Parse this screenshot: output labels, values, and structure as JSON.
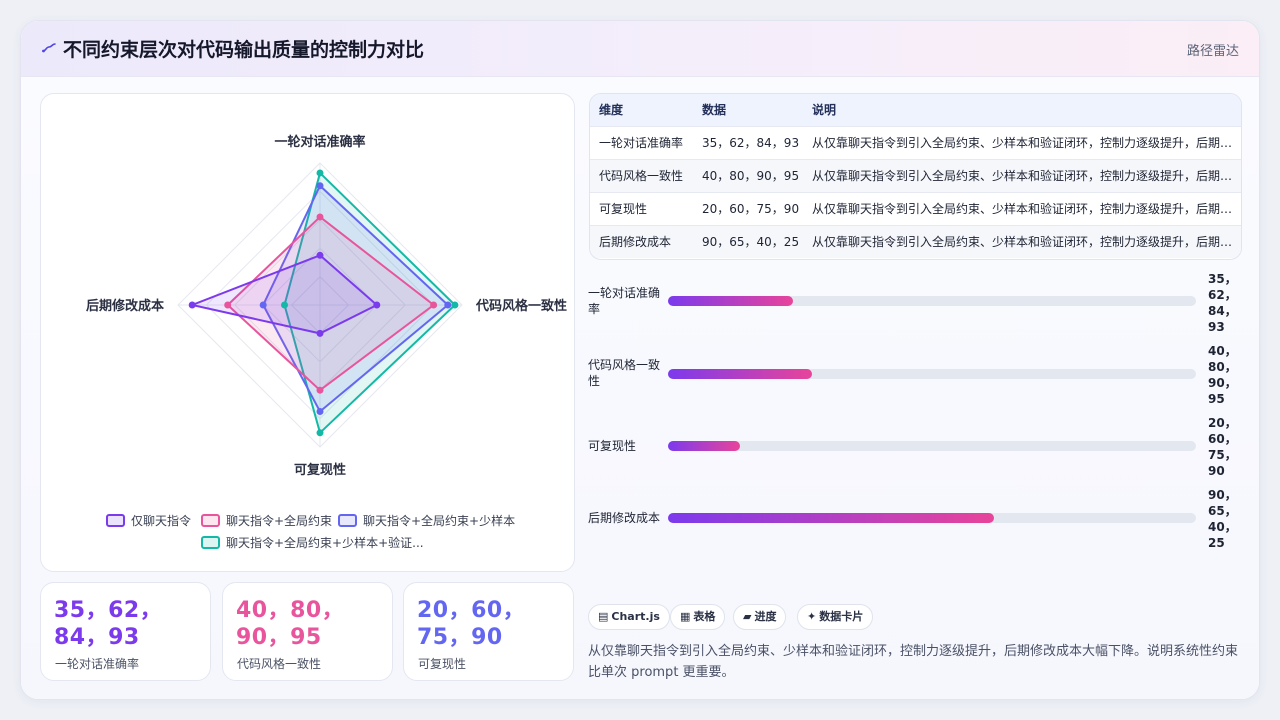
{
  "header": {
    "title": "不同约束层次对代码输出质量的控制力对比",
    "badge": "路径雷达",
    "logo_icon": "route-icon"
  },
  "chart_data": {
    "type": "radar",
    "axes": [
      "一轮对话准确率",
      "代码风格一致性",
      "可复现性",
      "后期修改成本"
    ],
    "range": [
      0,
      100
    ],
    "series": [
      {
        "name": "仅聊天指令",
        "values": [
          35,
          40,
          20,
          90
        ],
        "color": "#7c3aed"
      },
      {
        "name": "聊天指令+全局约束",
        "values": [
          62,
          80,
          60,
          65
        ],
        "color": "#e8559c"
      },
      {
        "name": "聊天指令+全局约束+少样本",
        "values": [
          84,
          90,
          75,
          40
        ],
        "color": "#6366f1"
      },
      {
        "name": "聊天指令+全局约束+少样本+验证...",
        "values": [
          93,
          95,
          90,
          25
        ],
        "color": "#14b8a6"
      }
    ],
    "legend_position": "bottom"
  },
  "kpis": [
    {
      "value": "35，62，84，93",
      "label": "一轮对话准确率",
      "color": "#7c3aed"
    },
    {
      "value": "40，80，90，95",
      "label": "代码风格一致性",
      "color": "#e8559c"
    },
    {
      "value": "20，60，75，90",
      "label": "可复现性",
      "color": "#6366f1"
    }
  ],
  "table": {
    "headers": [
      "维度",
      "数据",
      "说明"
    ],
    "rows": [
      [
        "一轮对话准确率",
        "35，62，84，93",
        "从仅靠聊天指令到引入全局约束、少样本和验证闭环，控制力逐级提升，后期修改成本大幅下降。"
      ],
      [
        "代码风格一致性",
        "40，80，90，95",
        "从仅靠聊天指令到引入全局约束、少样本和验证闭环，控制力逐级提升，后期修改成本大幅下降。"
      ],
      [
        "可复现性",
        "20，60，75，90",
        "从仅靠聊天指令到引入全局约束、少样本和验证闭环，控制力逐级提升，后期修改成本大幅下降。"
      ],
      [
        "后期修改成本",
        "90，65，40，25",
        "从仅靠聊天指令到引入全局约束、少样本和验证闭环，控制力逐级提升，后期修改成本大幅下降。"
      ]
    ]
  },
  "progress": [
    {
      "label": "一轮对话准确率",
      "value_text": "35，62，84，93",
      "fill_pct": 23.6
    },
    {
      "label": "代码风格一致性",
      "value_text": "40，80，90，95",
      "fill_pct": 27.3
    },
    {
      "label": "可复现性",
      "value_text": "20，60，75，90",
      "fill_pct": 13.6
    },
    {
      "label": "后期修改成本",
      "value_text": "90，65，40，25",
      "fill_pct": 61.8
    }
  ],
  "chips": [
    {
      "label": "Chart.js",
      "icon": "chart-icon",
      "glyph": "▤"
    },
    {
      "label": "表格",
      "icon": "table-icon",
      "glyph": "▦"
    },
    {
      "label": "进度",
      "icon": "progress-icon",
      "glyph": "▰"
    },
    {
      "label": "数据卡片",
      "icon": "sparkle-icon",
      "glyph": "✦"
    }
  ],
  "summary": "从仅靠聊天指令到引入全局约束、少样本和验证闭环，控制力逐级提升，后期修改成本大幅下降。说明系统性约束比单次 prompt 更重要。"
}
